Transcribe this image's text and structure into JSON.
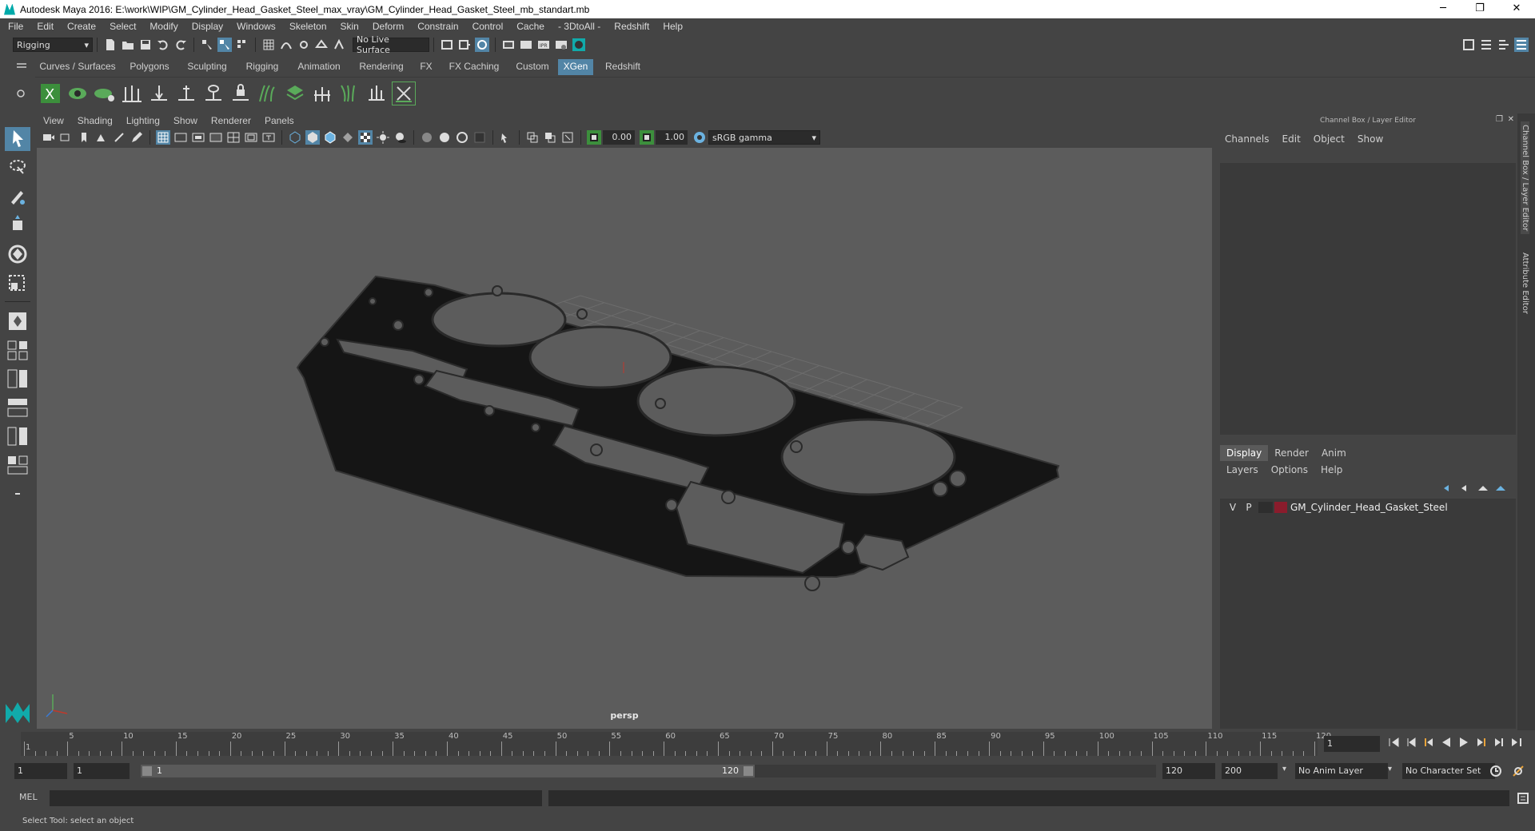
{
  "window": {
    "title": "Autodesk Maya 2016: E:\\work\\WIP\\GM_Cylinder_Head_Gasket_Steel_max_vray\\GM_Cylinder_Head_Gasket_Steel_mb_standart.mb",
    "minimize": "─",
    "restore": "❐",
    "close": "✕"
  },
  "menubar": [
    "File",
    "Edit",
    "Create",
    "Select",
    "Modify",
    "Display",
    "Windows",
    "Skeleton",
    "Skin",
    "Deform",
    "Constrain",
    "Control",
    "Cache",
    "- 3DtoAll -",
    "Redshift",
    "Help"
  ],
  "statusline": {
    "mode": "Rigging",
    "live_surface": "No Live Surface"
  },
  "shelf_tabs": [
    "Curves / Surfaces",
    "Polygons",
    "Sculpting",
    "Rigging",
    "Animation",
    "Rendering",
    "FX",
    "FX Caching",
    "Custom",
    "XGen",
    "Redshift"
  ],
  "active_shelf_tab": "XGen",
  "viewport": {
    "menu": [
      "View",
      "Shading",
      "Lighting",
      "Show",
      "Renderer",
      "Panels"
    ],
    "exposure": "0.00",
    "gamma": "1.00",
    "color_space": "sRGB gamma",
    "camera_label": "persp"
  },
  "channel_box": {
    "title": "Channel Box / Layer Editor",
    "menu": [
      "Channels",
      "Edit",
      "Object",
      "Show"
    ]
  },
  "layer_editor": {
    "tabs": [
      "Display",
      "Render",
      "Anim"
    ],
    "active_tab": "Display",
    "menu": [
      "Layers",
      "Options",
      "Help"
    ],
    "layers": [
      {
        "visible": "V",
        "playback": "P",
        "name": "GM_Cylinder_Head_Gasket_Steel",
        "color": "#8a1c2c"
      }
    ]
  },
  "side_tabs": [
    "Channel Box / Layer Editor",
    "Attribute Editor"
  ],
  "timeline": {
    "ticks": [
      "1",
      "5",
      "10",
      "15",
      "20",
      "25",
      "30",
      "35",
      "40",
      "45",
      "50",
      "55",
      "60",
      "65",
      "70",
      "75",
      "80",
      "85",
      "90",
      "95",
      "100",
      "105",
      "110",
      "115",
      "120"
    ],
    "current_frame": "1"
  },
  "range": {
    "start": "1",
    "playback_start": "1",
    "slider_start": "1",
    "slider_end": "120",
    "playback_end": "120",
    "end": "200",
    "anim_layer": "No Anim Layer",
    "character_set": "No Character Set"
  },
  "command_line": {
    "label": "MEL"
  },
  "help_line": "Select Tool: select an object"
}
